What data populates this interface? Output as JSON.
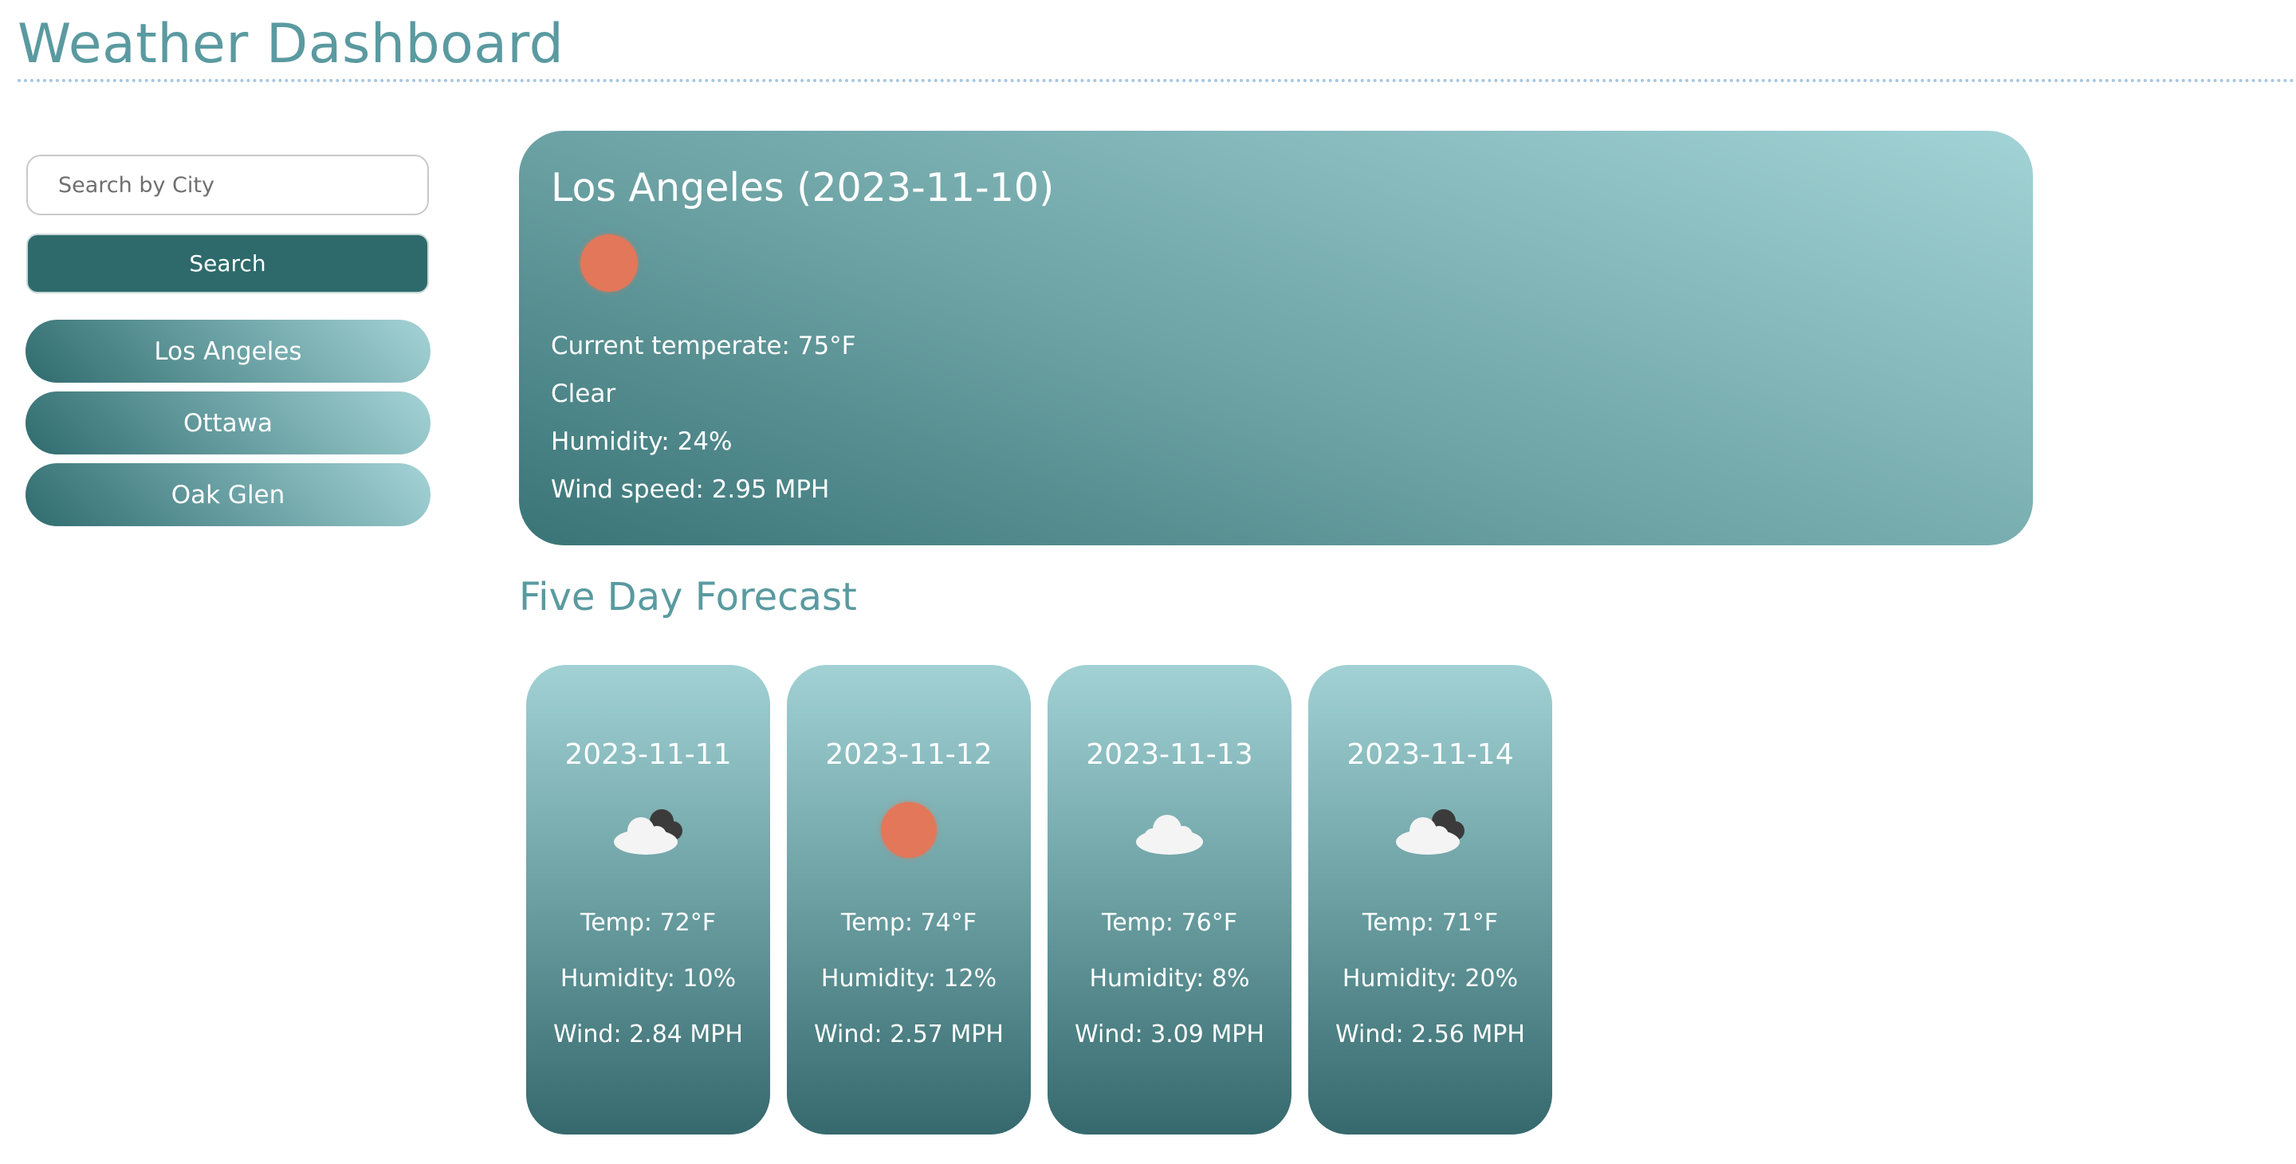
{
  "header": {
    "title": "Weather Dashboard"
  },
  "sidebar": {
    "search_placeholder": "Search by City",
    "search_button_label": "Search",
    "history": [
      {
        "label": "Los Angeles"
      },
      {
        "label": "Ottawa"
      },
      {
        "label": "Oak Glen"
      }
    ]
  },
  "current": {
    "title": "Los Angeles (2023-11-10)",
    "icon": "sun-icon",
    "temperature": "Current temperate: 75°F",
    "condition": "Clear",
    "humidity": "Humidity: 24%",
    "wind": "Wind speed: 2.95 MPH"
  },
  "forecast": {
    "heading": "Five Day Forecast",
    "days": [
      {
        "date": "2023-11-11",
        "icon": "partly-cloudy-icon",
        "temp": "Temp: 72°F",
        "humidity": "Humidity: 10%",
        "wind": "Wind: 2.84 MPH"
      },
      {
        "date": "2023-11-12",
        "icon": "sun-icon",
        "temp": "Temp: 74°F",
        "humidity": "Humidity: 12%",
        "wind": "Wind: 2.57 MPH"
      },
      {
        "date": "2023-11-13",
        "icon": "cloud-icon",
        "temp": "Temp: 76°F",
        "humidity": "Humidity: 8%",
        "wind": "Wind: 3.09 MPH"
      },
      {
        "date": "2023-11-14",
        "icon": "partly-cloudy-icon",
        "temp": "Temp: 71°F",
        "humidity": "Humidity: 20%",
        "wind": "Wind: 2.56 MPH"
      }
    ]
  },
  "colors": {
    "accent": "#5a9aa0",
    "button": "#2e6a6b",
    "sun": "#e2775a"
  }
}
